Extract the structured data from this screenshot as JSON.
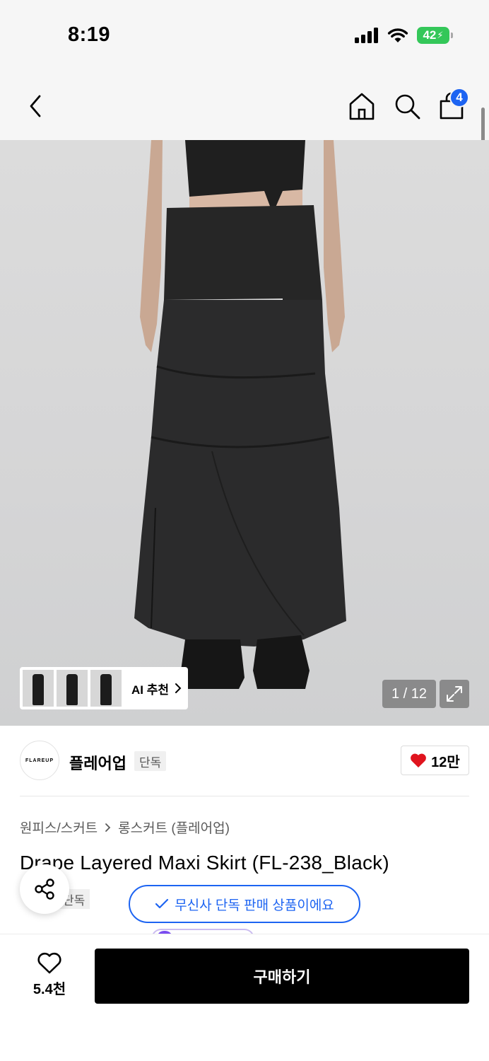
{
  "status_bar": {
    "time": "8:19",
    "battery": "42",
    "icons": [
      "cellular-signal-icon",
      "wifi-icon",
      "battery-charging-icon"
    ]
  },
  "nav": {
    "icons": [
      "back-chevron-icon",
      "home-icon",
      "search-icon",
      "shopping-bag-icon"
    ],
    "cart_count": "4"
  },
  "gallery": {
    "ai_label": "AI 추천",
    "counter": "1 / 12",
    "icons": [
      "chevron-right-icon",
      "expand-icon"
    ]
  },
  "brand": {
    "logo_text": "FLAREUP",
    "name": "플레어업",
    "tag": "단독",
    "likes": "12만"
  },
  "product": {
    "breadcrumb": [
      "원피스/스커트",
      "롱스커트 (플레어업)"
    ],
    "title": "Drape Layered Maxi Skirt (FL-238_Black)",
    "tag": "단독",
    "exclusive_notice": "무신사 단독 판매 상품이에요"
  },
  "bottom_bar": {
    "wish_count": "5.4천",
    "buy_label": "구매하기"
  },
  "colors": {
    "accent_blue": "#1d64f2",
    "heart_red": "#e0141e",
    "battery_green": "#34c759",
    "buy_button": "#000000"
  }
}
